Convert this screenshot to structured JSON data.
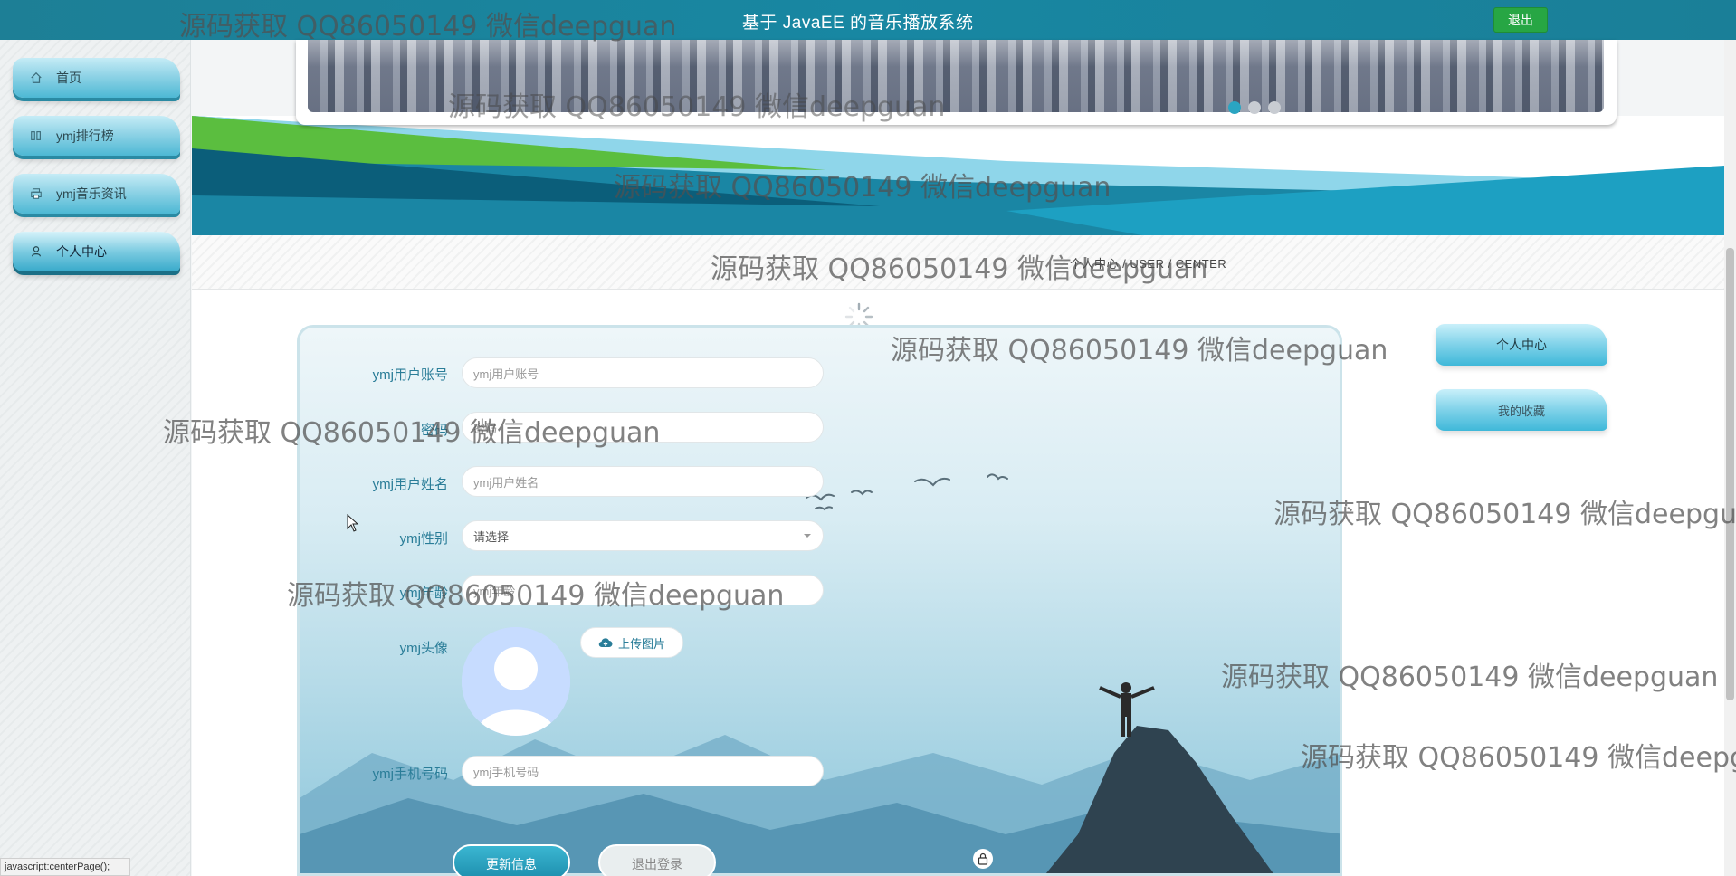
{
  "header": {
    "title": "基于 JavaEE 的音乐播放系统",
    "logout_label": "退出"
  },
  "sidebar": {
    "items": [
      {
        "label": "首页",
        "icon": "home-icon"
      },
      {
        "label": "ymj排行榜",
        "icon": "columns-icon"
      },
      {
        "label": "ymj音乐资讯",
        "icon": "print-icon"
      },
      {
        "label": "个人中心",
        "icon": "user-icon",
        "active": true
      }
    ]
  },
  "section": {
    "title": "个人中心 / USER / CENTER"
  },
  "form": {
    "account": {
      "label": "ymj用户账号",
      "placeholder": "ymj用户账号"
    },
    "password": {
      "label": "密码",
      "placeholder": "密码"
    },
    "name": {
      "label": "ymj用户姓名",
      "placeholder": "ymj用户姓名"
    },
    "gender": {
      "label": "ymj性别",
      "placeholder": "请选择"
    },
    "age": {
      "label": "ymj年龄",
      "placeholder": "ymj年龄"
    },
    "avatar": {
      "label": "ymj头像",
      "upload_label": "上传图片"
    },
    "phone": {
      "label": "ymj手机号码",
      "placeholder": "ymj手机号码"
    },
    "update_label": "更新信息",
    "logout_label": "退出登录"
  },
  "right_menu": {
    "items": [
      "个人中心",
      "我的收藏"
    ]
  },
  "statusbar": {
    "text": "javascript:centerPage();"
  },
  "watermark": {
    "text": "源码获取 QQ86050149 微信deepguan"
  },
  "colors": {
    "topbar": "#1887a2",
    "accent": "#2a7d98",
    "logout_green": "#27a644"
  }
}
